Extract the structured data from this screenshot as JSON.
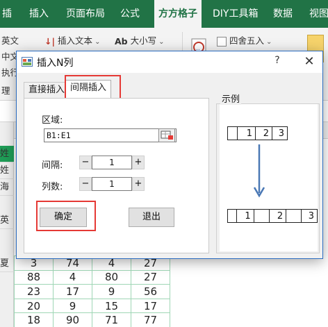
{
  "ribbon_tabs": [
    "插入",
    "页面布局",
    "公式",
    "方方格子",
    "DIY工具箱",
    "数据",
    "视图"
  ],
  "ribbon": {
    "left_labels": [
      "英文",
      "中文",
      "执行"
    ],
    "insert_text": "插入文本",
    "case": "大小写",
    "round": "四舍五入"
  },
  "dialog": {
    "title": "插入N列",
    "help": "?",
    "close": "✕",
    "tabs": [
      "直接插入",
      "间隔插入"
    ],
    "range_label": "区域:",
    "range_value": "B1:E1",
    "interval_label": "间隔:",
    "interval_value": "1",
    "columns_label": "列数:",
    "columns_value": "1",
    "stepper_minus": "−",
    "stepper_plus": "+",
    "ok": "确定",
    "cancel": "退出",
    "example_title": "示例",
    "example_before": [
      "",
      "1",
      "2",
      "3"
    ],
    "example_after": [
      "",
      "1",
      "",
      "2",
      "",
      "3"
    ]
  },
  "sheet": {
    "row_side_labels": [
      "姓",
      "海",
      "",
      "英",
      "",
      "",
      "夏",
      "",
      "",
      ""
    ],
    "rows": [
      [
        "3",
        "74",
        "4",
        "27"
      ],
      [
        "88",
        "4",
        "80",
        "27"
      ],
      [
        "23",
        "17",
        "9",
        "56"
      ],
      [
        "20",
        "9",
        "15",
        "17"
      ],
      [
        "18",
        "90",
        "71",
        "77"
      ]
    ]
  },
  "colors": {
    "accent": "#217346",
    "highlight": "#e53935",
    "arrow": "#4a78b5"
  }
}
